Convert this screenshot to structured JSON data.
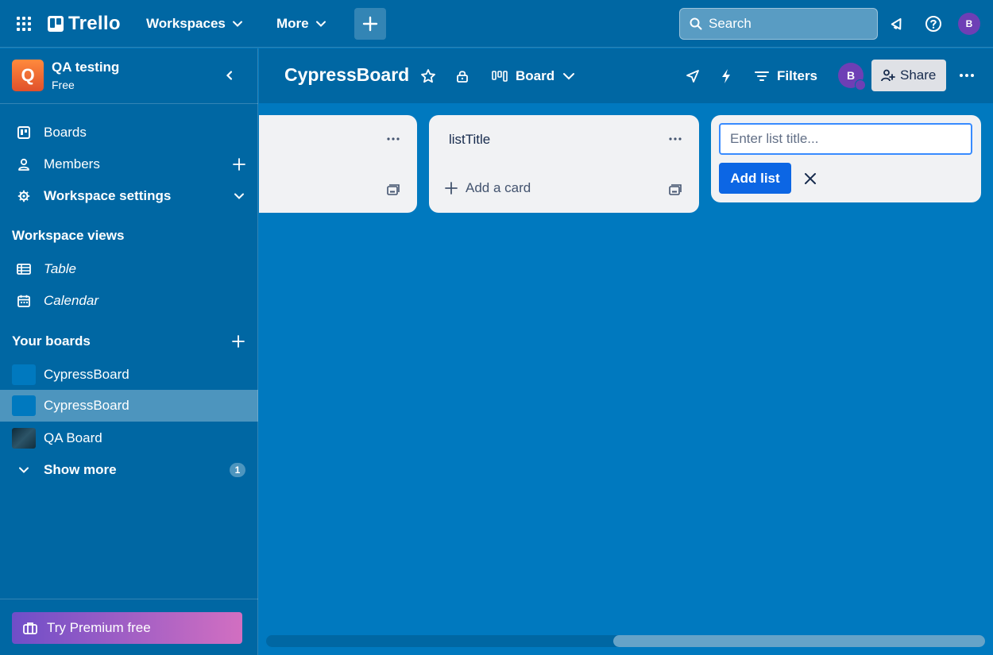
{
  "header": {
    "app_name": "Trello",
    "nav": {
      "workspaces": "Workspaces",
      "more": "More"
    },
    "search": {
      "placeholder": "Search"
    },
    "user_initial": "B"
  },
  "sidebar": {
    "workspace": {
      "initial": "Q",
      "name": "QA testing",
      "plan": "Free"
    },
    "items": [
      {
        "label": "Boards",
        "icon": "board-icon"
      },
      {
        "label": "Members",
        "icon": "person-icon"
      },
      {
        "label": "Workspace settings",
        "icon": "gear-icon"
      }
    ],
    "views_heading": "Workspace views",
    "views": [
      {
        "label": "Table",
        "icon": "table-icon"
      },
      {
        "label": "Calendar",
        "icon": "calendar-icon"
      }
    ],
    "boards_heading": "Your boards",
    "boards": [
      {
        "label": "CypressBoard",
        "color": "#0079bf"
      },
      {
        "label": "CypressBoard",
        "color": "#0079bf",
        "active": true
      },
      {
        "label": "QA Board",
        "color": "#1f3b4d"
      }
    ],
    "show_more": "Show more",
    "show_more_count": "1",
    "premium": "Try Premium free"
  },
  "board": {
    "title": "CypressBoard",
    "view": "Board",
    "filters": "Filters",
    "member_initial": "B",
    "share": "Share"
  },
  "lists": [
    {
      "title": "",
      "add_card": ""
    },
    {
      "title": "listTitle",
      "add_card": "Add a card"
    }
  ],
  "add_list": {
    "placeholder": "Enter list title...",
    "button": "Add list"
  },
  "colors": {
    "board_bg": "#0079bf",
    "header_bg": "#0067a3",
    "primary_button": "#0c66e4",
    "list_bg": "#f1f2f4"
  }
}
